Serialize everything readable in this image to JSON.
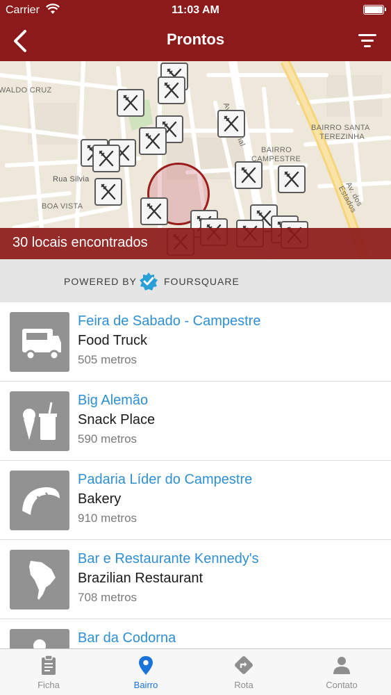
{
  "status_bar": {
    "carrier": "Carrier",
    "time": "11:03 AM"
  },
  "nav": {
    "title": "Prontos",
    "back_icon": "chevron-left-icon",
    "filter_icon": "filter-icon"
  },
  "map": {
    "labels": {
      "waldo_cruz": "WALDO CRUZ",
      "rua_silvia": "Rua Silvia",
      "boa_vista": "BOA VISTA",
      "av_industrial": "Av. Industrial",
      "bairro_santa": "BAIRRO SANTA",
      "terezinha": "TEREZINHA",
      "bairro": "BAIRRO",
      "campestre": "CAMPESTRE",
      "av_dos_estados": "Av. dos Estados"
    },
    "pin_icon": "fork-knife-icon",
    "found_text": "30 locais encontrados"
  },
  "powered": {
    "prefix": "POWERED BY",
    "brand": "FOURSQUARE",
    "logo_icon": "foursquare-logo"
  },
  "places": [
    {
      "name": "Feira de Sabado - Campestre",
      "category": "Food Truck",
      "distance": "505 metros",
      "icon": "food-truck-icon"
    },
    {
      "name": "Big Alemão",
      "category": "Snack Place",
      "distance": "590 metros",
      "icon": "snack-icon"
    },
    {
      "name": "Padaria Líder do Campestre",
      "category": "Bakery",
      "distance": "910 metros",
      "icon": "croissant-icon"
    },
    {
      "name": "Bar e Restaurante Kennedy's",
      "category": "Brazilian Restaurant",
      "distance": "708 metros",
      "icon": "south-america-icon"
    },
    {
      "name": "Bar da Codorna",
      "category": "",
      "distance": "",
      "icon": "bar-icon"
    }
  ],
  "tabs": [
    {
      "label": "Ficha",
      "icon": "clipboard-icon",
      "active": false
    },
    {
      "label": "Bairro",
      "icon": "map-pin-icon",
      "active": true
    },
    {
      "label": "Rota",
      "icon": "route-sign-icon",
      "active": false
    },
    {
      "label": "Contato",
      "icon": "person-icon",
      "active": false
    }
  ],
  "colors": {
    "brand": "#8c1a1a",
    "link": "#2e8fd1",
    "tab_active": "#1a73d8",
    "foursquare": "#2a9fd6"
  }
}
